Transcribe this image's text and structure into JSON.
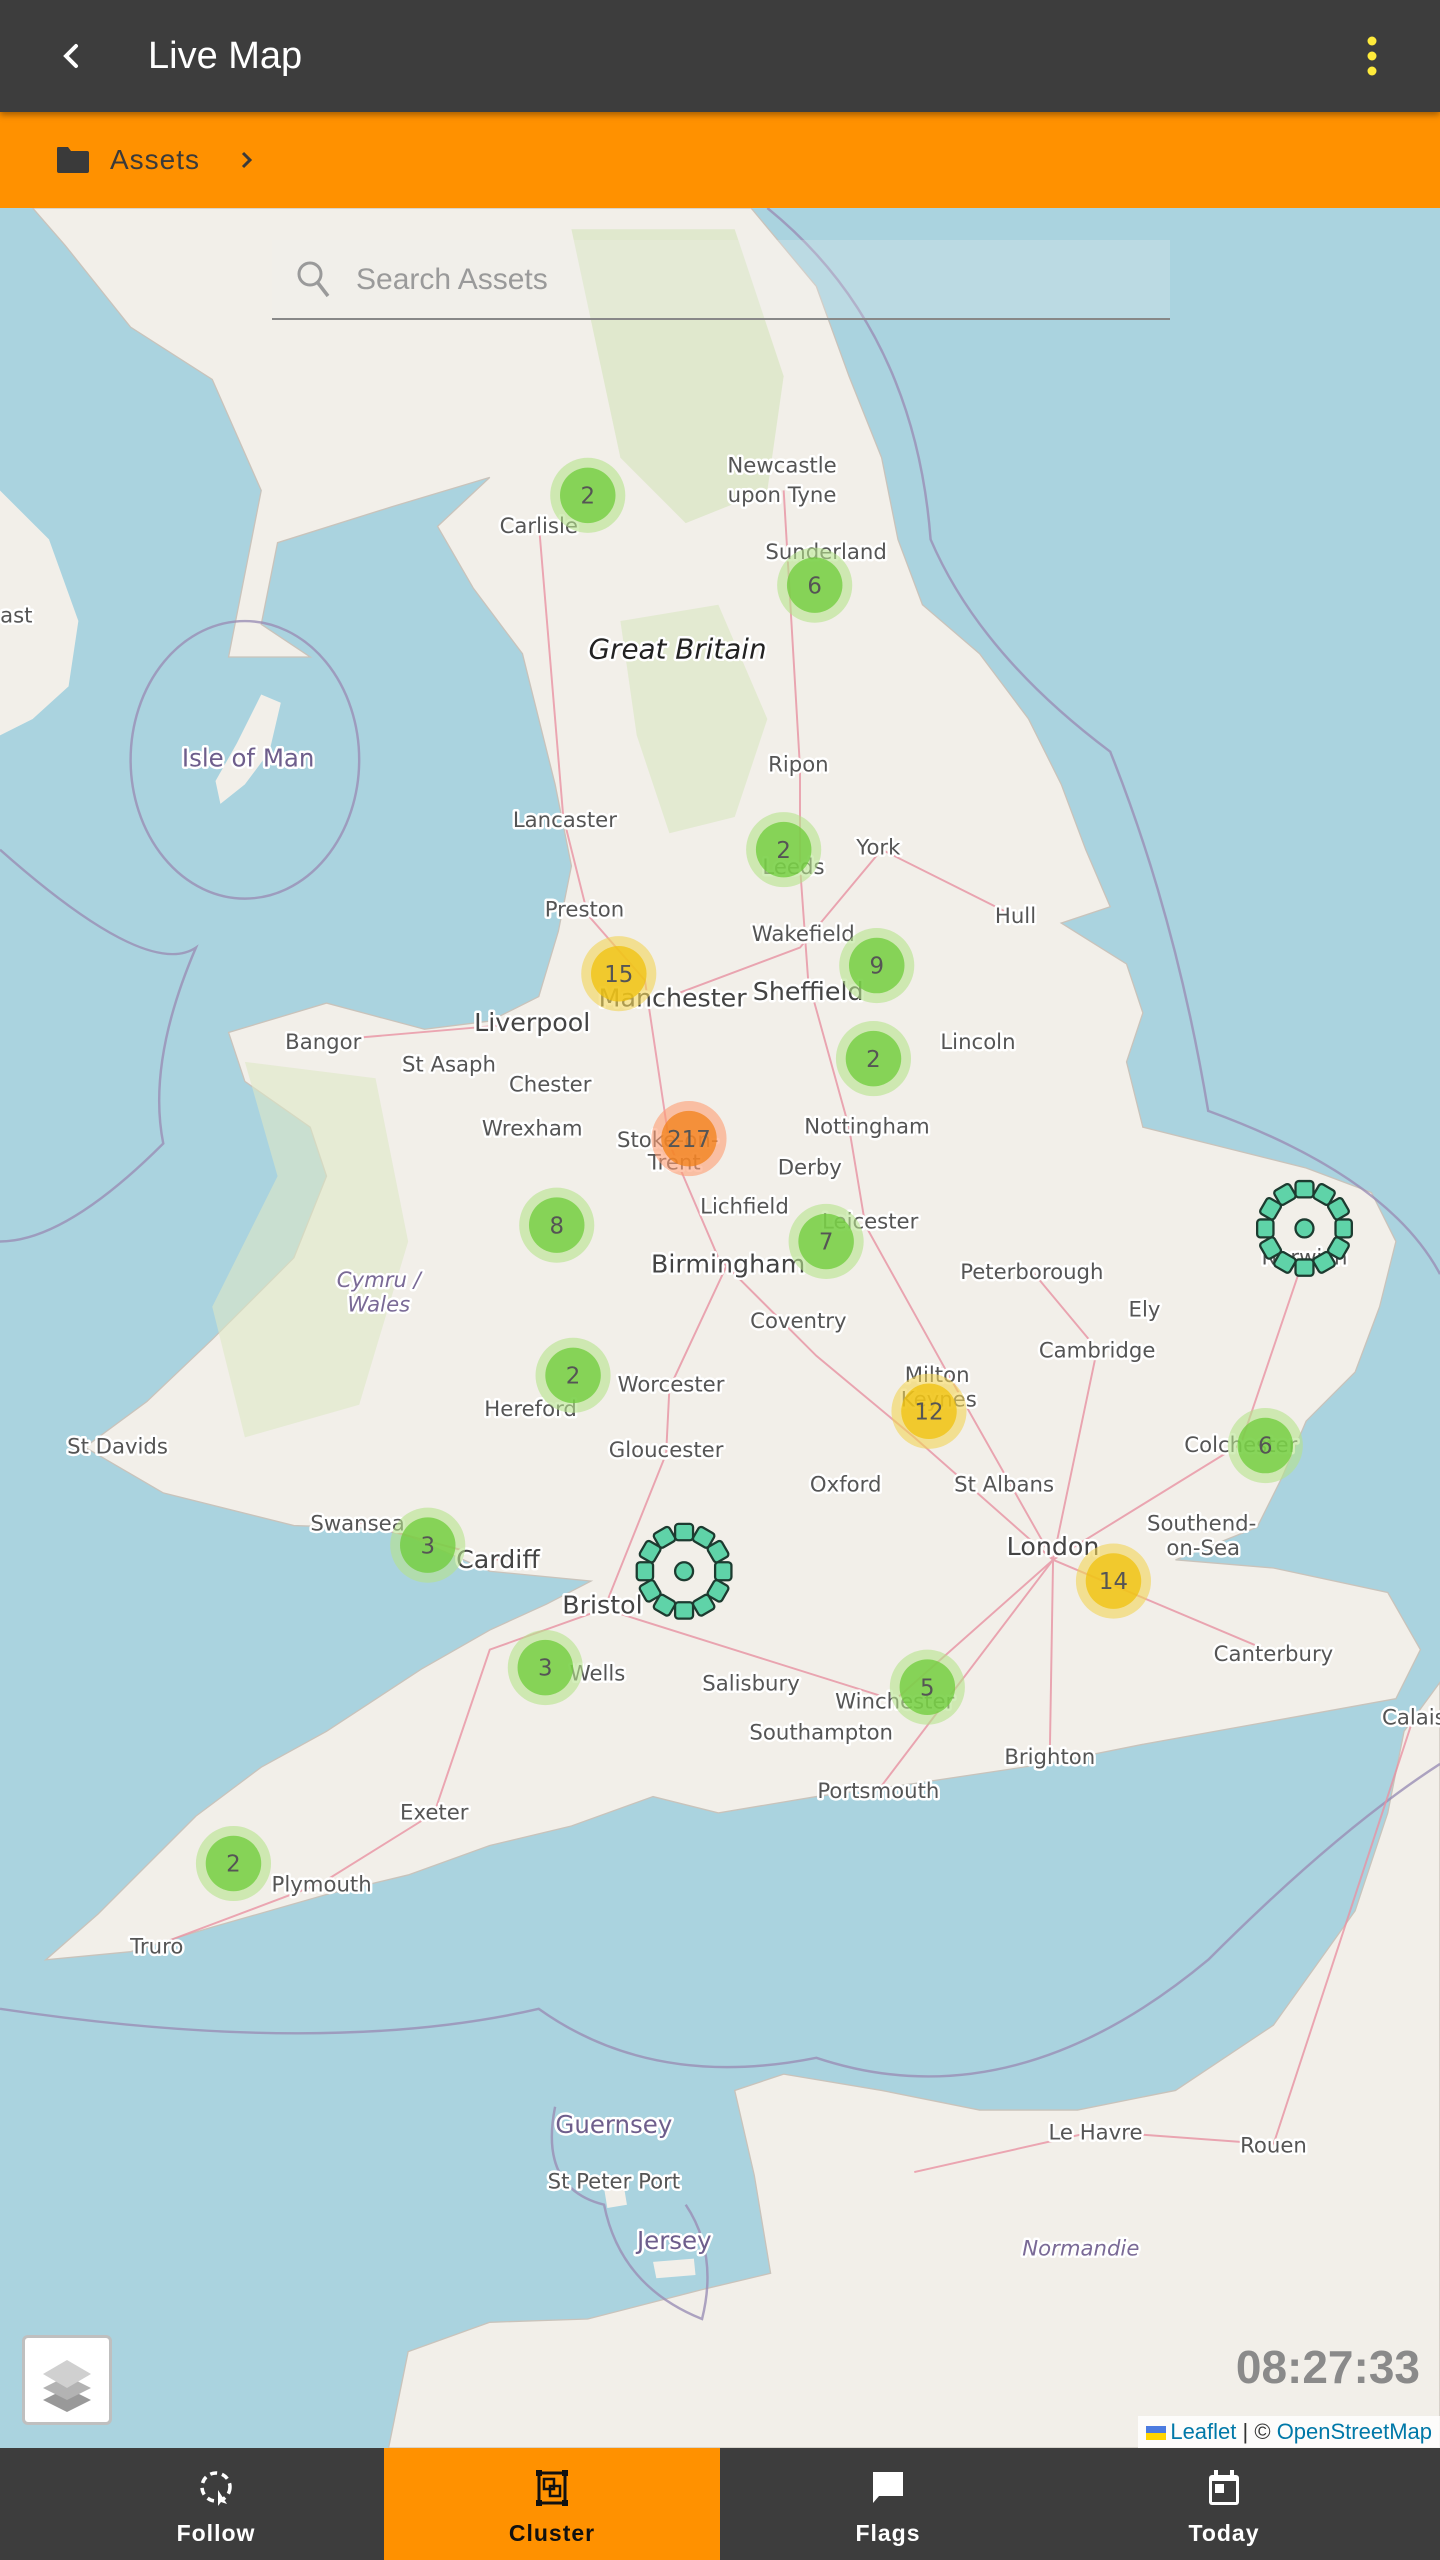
{
  "header": {
    "title": "Live Map",
    "back_icon": "chevron-left-icon",
    "menu_icon": "more-vertical-icon",
    "menu_icon_color": "#ffeb3b"
  },
  "breadcrumb": {
    "icon": "folder-icon",
    "label": "Assets",
    "chevron": "chevron-right-icon"
  },
  "search": {
    "placeholder": "Search Assets",
    "value": ""
  },
  "map": {
    "labels": [
      "Newcastle",
      "upon Tyne",
      "Carlisle",
      "Sunderland",
      "Great Britain",
      "Isle of Man",
      "ast",
      "Ripon",
      "Lancaster",
      "York",
      "Leeds",
      "Preston",
      "Wakefield",
      "Hull",
      "Manchester",
      "Sheffield",
      "Liverpool",
      "Bangor",
      "St Asaph",
      "Lincoln",
      "Chester",
      "Wrexham",
      "Stoke-on-",
      "Trent",
      "Nottingham",
      "Derby",
      "Lichfield",
      "Leicester",
      "Birmingham",
      "Peterborough",
      "Cymru /",
      "Wales",
      "Norwich",
      "Ely",
      "Coventry",
      "Cambridge",
      "Milton",
      "Keynes",
      "Worcester",
      "Hereford",
      "St Davids",
      "Gloucester",
      "Colchester",
      "Oxford",
      "St Albans",
      "Swansea",
      "Cardiff",
      "London",
      "Southend-",
      "on-Sea",
      "Bristol",
      "Wells",
      "Salisbury",
      "Canterbury",
      "Calais",
      "Winchester",
      "Southampton",
      "Brighton",
      "Portsmouth",
      "Exeter",
      "Plymouth",
      "Truro",
      "Guernsey",
      "St Peter Port",
      "Jersey",
      "Normandie",
      "Le Havre",
      "Rouen"
    ],
    "clusters": [
      {
        "count": "2",
        "level": "small"
      },
      {
        "count": "6",
        "level": "small"
      },
      {
        "count": "2",
        "level": "small"
      },
      {
        "count": "15",
        "level": "medium"
      },
      {
        "count": "9",
        "level": "small"
      },
      {
        "count": "2",
        "level": "small"
      },
      {
        "count": "217",
        "level": "large"
      },
      {
        "count": "8",
        "level": "small"
      },
      {
        "count": "7",
        "level": "small"
      },
      {
        "count": "2",
        "level": "small"
      },
      {
        "count": "12",
        "level": "medium"
      },
      {
        "count": "6",
        "level": "small"
      },
      {
        "count": "3",
        "level": "small"
      },
      {
        "count": "14",
        "level": "medium"
      },
      {
        "count": "3",
        "level": "small"
      },
      {
        "count": "5",
        "level": "small"
      },
      {
        "count": "2",
        "level": "small"
      }
    ],
    "cluster_colors": {
      "small": {
        "outer": "#b5e28c",
        "inner": "#6ecc39"
      },
      "medium": {
        "outer": "#f1d357",
        "inner": "#f0c20c"
      },
      "large": {
        "outer": "#fd9c73",
        "inner": "#f18017"
      }
    },
    "spider_marker_color": "#5fd3a8",
    "sea_color": "#aad3df",
    "land_color": "#f2efe9"
  },
  "layers_button": {
    "icon": "layers-icon"
  },
  "clock": "08:27:33",
  "attribution": {
    "leaflet": "Leaflet",
    "separator": "| ©",
    "osm": "OpenStreetMap"
  },
  "nav": {
    "tabs": [
      {
        "label": "Follow",
        "icon": "follow-icon",
        "active": false
      },
      {
        "label": "Cluster",
        "icon": "cluster-icon",
        "active": true
      },
      {
        "label": "Flags",
        "icon": "flag-comment-icon",
        "active": false
      },
      {
        "label": "Today",
        "icon": "calendar-today-icon",
        "active": false
      }
    ]
  },
  "accent_color": "#ff9100"
}
